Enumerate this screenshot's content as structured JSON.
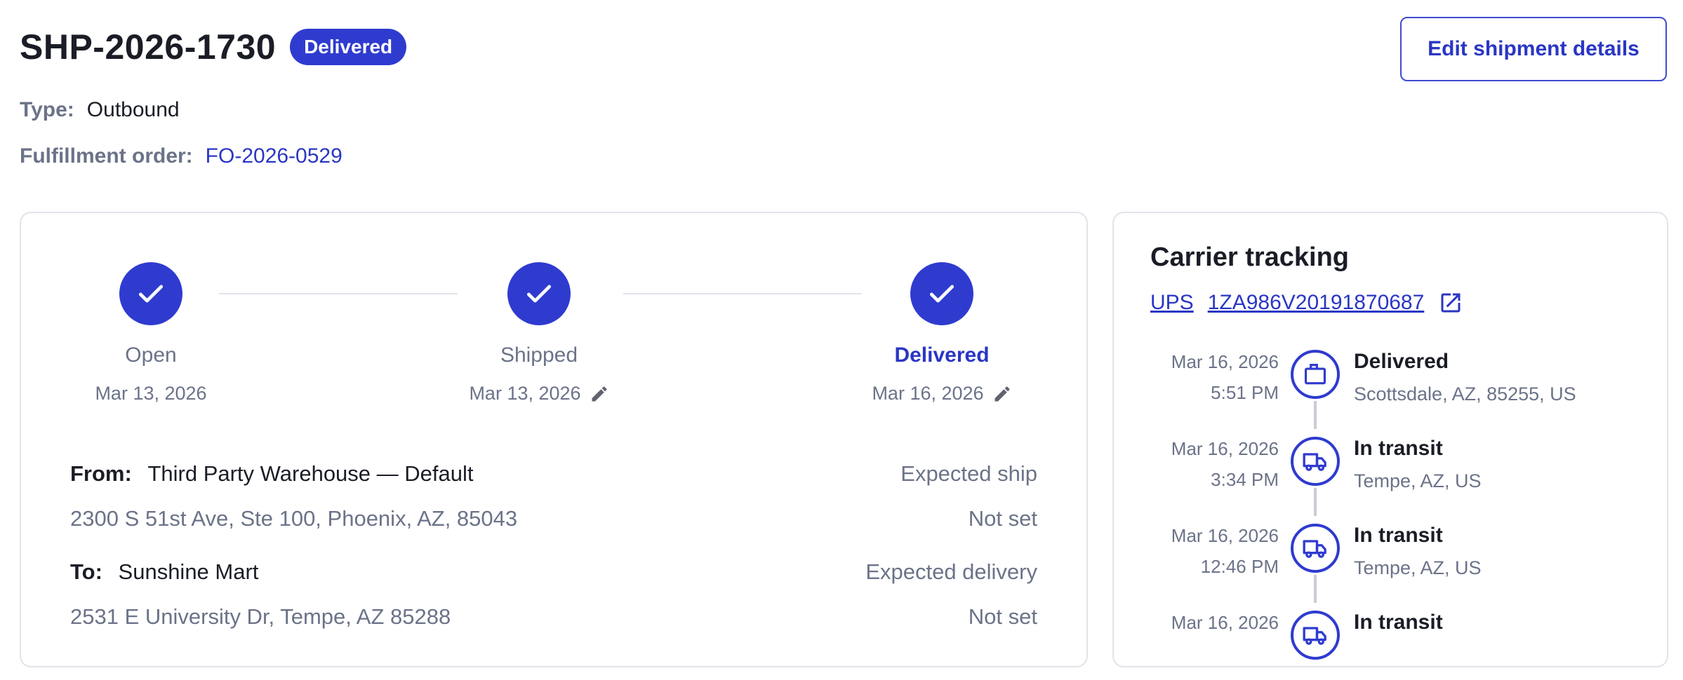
{
  "header": {
    "shipment_id": "SHP-2026-1730",
    "status": "Delivered",
    "edit_label": "Edit shipment details",
    "type_label": "Type:",
    "type_value": "Outbound",
    "fo_label": "Fulfillment order:",
    "fo_value": "FO-2026-0529"
  },
  "stepper": {
    "steps": [
      {
        "label": "Open",
        "date": "Mar 13, 2026",
        "active": false,
        "editable": false
      },
      {
        "label": "Shipped",
        "date": "Mar 13, 2026",
        "active": false,
        "editable": true
      },
      {
        "label": "Delivered",
        "date": "Mar 16, 2026",
        "active": true,
        "editable": true
      }
    ]
  },
  "addresses": {
    "from_label": "From:",
    "from_name": "Third Party Warehouse — Default",
    "from_address": "2300 S 51st Ave, Ste 100, Phoenix, AZ, 85043",
    "to_label": "To:",
    "to_name": "Sunshine Mart",
    "to_address": "2531 E University Dr, Tempe, AZ 85288",
    "expected_ship_label": "Expected ship",
    "expected_ship_value": "Not set",
    "expected_delivery_label": "Expected delivery",
    "expected_delivery_value": "Not set"
  },
  "tracking": {
    "title": "Carrier tracking",
    "carrier": "UPS",
    "tracking_number": "1ZA986V20191870687",
    "events": [
      {
        "date": "Mar 16, 2026",
        "time": "5:51 PM",
        "status": "Delivered",
        "location": "Scottsdale, AZ, 85255, US",
        "icon": "package-icon"
      },
      {
        "date": "Mar 16, 2026",
        "time": "3:34 PM",
        "status": "In transit",
        "location": "Tempe, AZ, US",
        "icon": "truck-icon"
      },
      {
        "date": "Mar 16, 2026",
        "time": "12:46 PM",
        "status": "In transit",
        "location": "Tempe, AZ, US",
        "icon": "truck-icon"
      },
      {
        "date": "Mar 16, 2026",
        "time": "",
        "status": "In transit",
        "location": "",
        "icon": "truck-icon"
      }
    ]
  },
  "colors": {
    "accent": "#2f3bcf",
    "link": "#2a36c4",
    "muted_text": "#6b7388",
    "border": "#e1e4ea"
  }
}
